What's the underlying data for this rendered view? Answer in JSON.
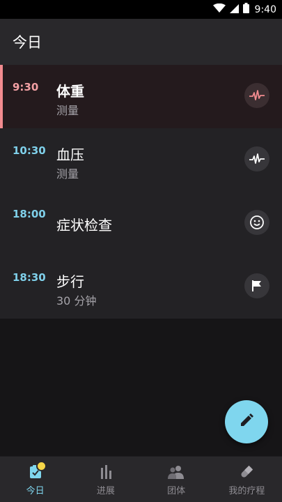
{
  "status_bar": {
    "time": "9:40"
  },
  "app_bar": {
    "title": "今日"
  },
  "schedule": [
    {
      "time": "9:30",
      "name": "体重",
      "sub": "测量",
      "icon": "heart-rate-icon",
      "active": true
    },
    {
      "time": "10:30",
      "name": "血压",
      "sub": "测量",
      "icon": "pulse-icon",
      "active": false
    },
    {
      "time": "18:00",
      "name": "症状检查",
      "sub": "",
      "icon": "smiley-icon",
      "active": false
    },
    {
      "time": "18:30",
      "name": "步行",
      "sub": "30 分钟",
      "icon": "flag-icon",
      "active": false
    }
  ],
  "fab": {
    "icon": "pencil-icon"
  },
  "bottom_nav": [
    {
      "label": "今日",
      "icon": "today-checklist-icon",
      "active": true
    },
    {
      "label": "进展",
      "icon": "bar-chart-icon",
      "active": false
    },
    {
      "label": "团体",
      "icon": "group-icon",
      "active": false
    },
    {
      "label": "我的疗程",
      "icon": "pill-icon",
      "active": false
    }
  ],
  "colors": {
    "accent": "#7fd6ee",
    "active_accent": "#f28b8f",
    "badge": "#f6d648",
    "background": "#161517",
    "surface": "#232225"
  }
}
